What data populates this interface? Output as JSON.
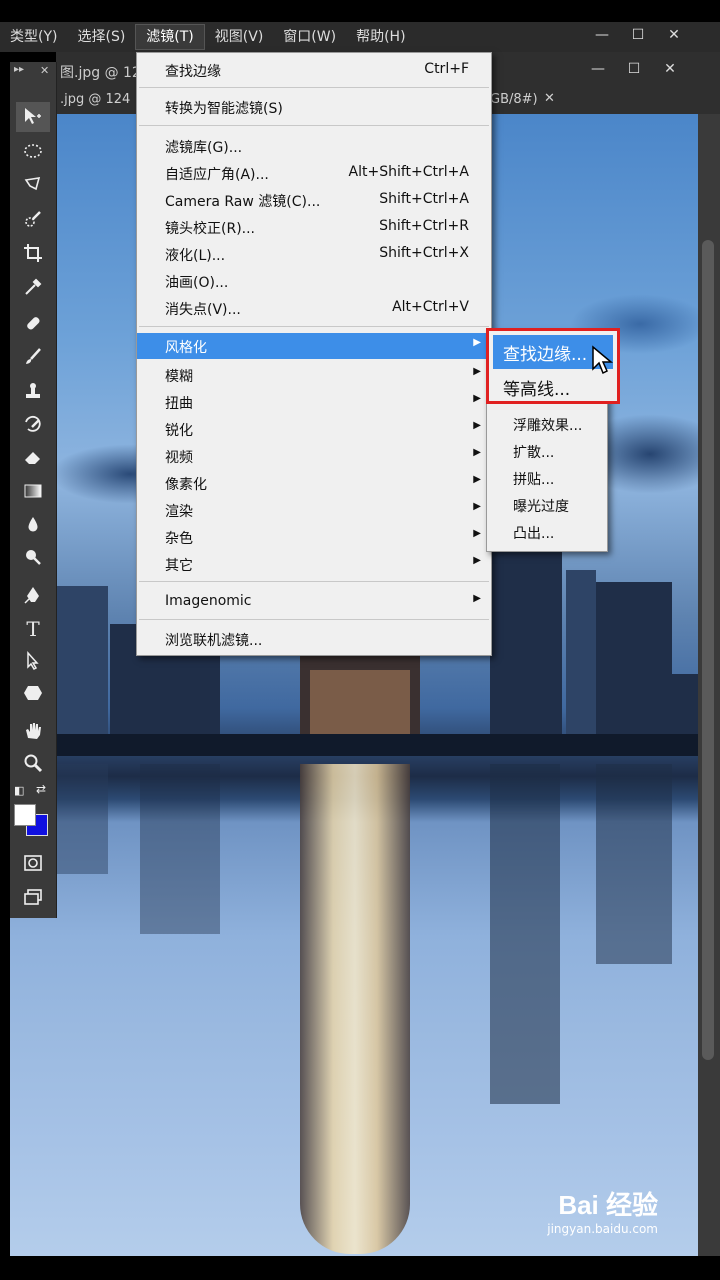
{
  "menubar": {
    "items": [
      "类型(Y)",
      "选择(S)",
      "滤镜(T)",
      "视图(V)",
      "窗口(W)",
      "帮助(H)"
    ],
    "active_index": 2
  },
  "document": {
    "tab_title_fragment": "图.jpg @ 12",
    "tab2_title_fragment": ".jpg @ 124",
    "tab_mode_fragment": "GB/8#)",
    "close_glyph": "✕"
  },
  "window_controls": {
    "minimize": "—",
    "restore": "☐",
    "close": "✕"
  },
  "filter_menu": {
    "last_filter": {
      "label": "查找边缘",
      "shortcut": "Ctrl+F"
    },
    "smart_filter": {
      "label": "转换为智能滤镜(S)"
    },
    "group1": [
      {
        "label": "滤镜库(G)...",
        "shortcut": ""
      },
      {
        "label": "自适应广角(A)...",
        "shortcut": "Alt+Shift+Ctrl+A"
      },
      {
        "label": "Camera Raw 滤镜(C)...",
        "shortcut": "Shift+Ctrl+A"
      },
      {
        "label": "镜头校正(R)...",
        "shortcut": "Shift+Ctrl+R"
      },
      {
        "label": "液化(L)...",
        "shortcut": "Shift+Ctrl+X"
      },
      {
        "label": "油画(O)...",
        "shortcut": ""
      },
      {
        "label": "消失点(V)...",
        "shortcut": "Alt+Ctrl+V"
      }
    ],
    "group2": [
      {
        "label": "风格化",
        "highlighted": true
      },
      {
        "label": "模糊"
      },
      {
        "label": "扭曲"
      },
      {
        "label": "锐化"
      },
      {
        "label": "视频"
      },
      {
        "label": "像素化"
      },
      {
        "label": "渲染"
      },
      {
        "label": "杂色"
      },
      {
        "label": "其它"
      }
    ],
    "imagenomic": "Imagenomic",
    "browse_online": "浏览联机滤镜..."
  },
  "stylize_submenu": {
    "items": [
      "查找边缘...",
      "等高线...",
      "浮雕效果...",
      "扩散...",
      "拼贴...",
      "曝光过度",
      "凸出..."
    ],
    "highlighted_index": 0
  },
  "watermark": {
    "brand": "Bai 经验",
    "url": "jingyan.baidu.com"
  },
  "colors": {
    "menu_highlight": "#3d8ee8",
    "annotation_box": "#e02020",
    "foreground_swatch": "#ffffff",
    "background_swatch": "#1010e0"
  }
}
